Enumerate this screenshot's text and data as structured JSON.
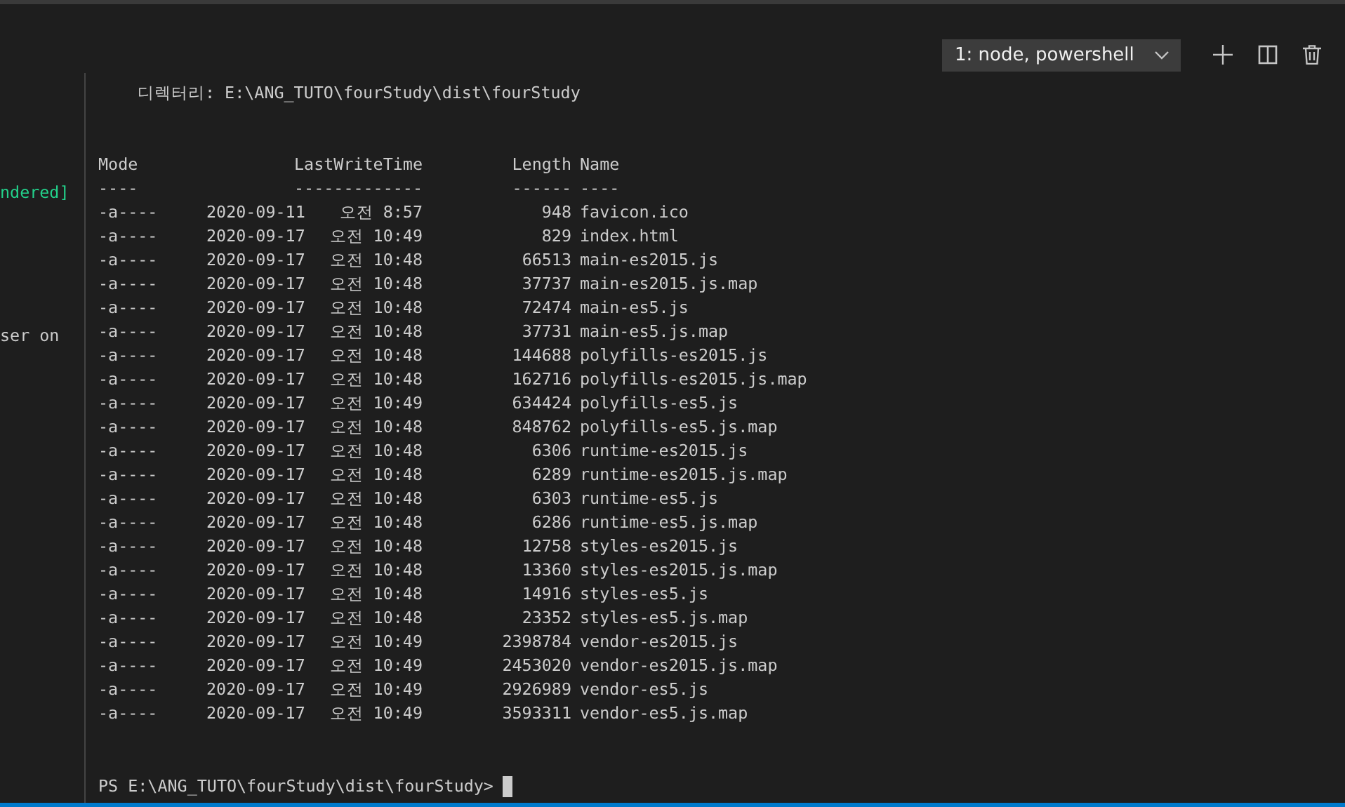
{
  "toolbar": {
    "terminal_select": {
      "value": "1: node, powershell"
    }
  },
  "left_pane": {
    "lines": [
      {
        "text": "ndered]",
        "kind": "success"
      },
      {
        "text": "ser on",
        "kind": "plain"
      }
    ]
  },
  "terminal": {
    "directory": {
      "label": "디렉터리:",
      "path": "E:\\ANG_TUTO\\fourStudy\\dist\\fourStudy"
    },
    "columns": [
      "Mode",
      "LastWriteTime",
      "Length",
      "Name"
    ],
    "underlines": [
      "----",
      "-------------",
      "------",
      "----"
    ],
    "rows": [
      {
        "mode": "-a----",
        "date": "2020-09-11",
        "time": "오전 8:57",
        "length": "948",
        "name": "favicon.ico"
      },
      {
        "mode": "-a----",
        "date": "2020-09-17",
        "time": "오전 10:49",
        "length": "829",
        "name": "index.html"
      },
      {
        "mode": "-a----",
        "date": "2020-09-17",
        "time": "오전 10:48",
        "length": "66513",
        "name": "main-es2015.js"
      },
      {
        "mode": "-a----",
        "date": "2020-09-17",
        "time": "오전 10:48",
        "length": "37737",
        "name": "main-es2015.js.map"
      },
      {
        "mode": "-a----",
        "date": "2020-09-17",
        "time": "오전 10:48",
        "length": "72474",
        "name": "main-es5.js"
      },
      {
        "mode": "-a----",
        "date": "2020-09-17",
        "time": "오전 10:48",
        "length": "37731",
        "name": "main-es5.js.map"
      },
      {
        "mode": "-a----",
        "date": "2020-09-17",
        "time": "오전 10:48",
        "length": "144688",
        "name": "polyfills-es2015.js"
      },
      {
        "mode": "-a----",
        "date": "2020-09-17",
        "time": "오전 10:48",
        "length": "162716",
        "name": "polyfills-es2015.js.map"
      },
      {
        "mode": "-a----",
        "date": "2020-09-17",
        "time": "오전 10:49",
        "length": "634424",
        "name": "polyfills-es5.js"
      },
      {
        "mode": "-a----",
        "date": "2020-09-17",
        "time": "오전 10:48",
        "length": "848762",
        "name": "polyfills-es5.js.map"
      },
      {
        "mode": "-a----",
        "date": "2020-09-17",
        "time": "오전 10:48",
        "length": "6306",
        "name": "runtime-es2015.js"
      },
      {
        "mode": "-a----",
        "date": "2020-09-17",
        "time": "오전 10:48",
        "length": "6289",
        "name": "runtime-es2015.js.map"
      },
      {
        "mode": "-a----",
        "date": "2020-09-17",
        "time": "오전 10:48",
        "length": "6303",
        "name": "runtime-es5.js"
      },
      {
        "mode": "-a----",
        "date": "2020-09-17",
        "time": "오전 10:48",
        "length": "6286",
        "name": "runtime-es5.js.map"
      },
      {
        "mode": "-a----",
        "date": "2020-09-17",
        "time": "오전 10:48",
        "length": "12758",
        "name": "styles-es2015.js"
      },
      {
        "mode": "-a----",
        "date": "2020-09-17",
        "time": "오전 10:48",
        "length": "13360",
        "name": "styles-es2015.js.map"
      },
      {
        "mode": "-a----",
        "date": "2020-09-17",
        "time": "오전 10:48",
        "length": "14916",
        "name": "styles-es5.js"
      },
      {
        "mode": "-a----",
        "date": "2020-09-17",
        "time": "오전 10:48",
        "length": "23352",
        "name": "styles-es5.js.map"
      },
      {
        "mode": "-a----",
        "date": "2020-09-17",
        "time": "오전 10:49",
        "length": "2398784",
        "name": "vendor-es2015.js"
      },
      {
        "mode": "-a----",
        "date": "2020-09-17",
        "time": "오전 10:49",
        "length": "2453020",
        "name": "vendor-es2015.js.map"
      },
      {
        "mode": "-a----",
        "date": "2020-09-17",
        "time": "오전 10:49",
        "length": "2926989",
        "name": "vendor-es5.js"
      },
      {
        "mode": "-a----",
        "date": "2020-09-17",
        "time": "오전 10:49",
        "length": "3593311",
        "name": "vendor-es5.js.map"
      }
    ],
    "prompt": "PS E:\\ANG_TUTO\\fourStudy\\dist\\fourStudy>"
  }
}
